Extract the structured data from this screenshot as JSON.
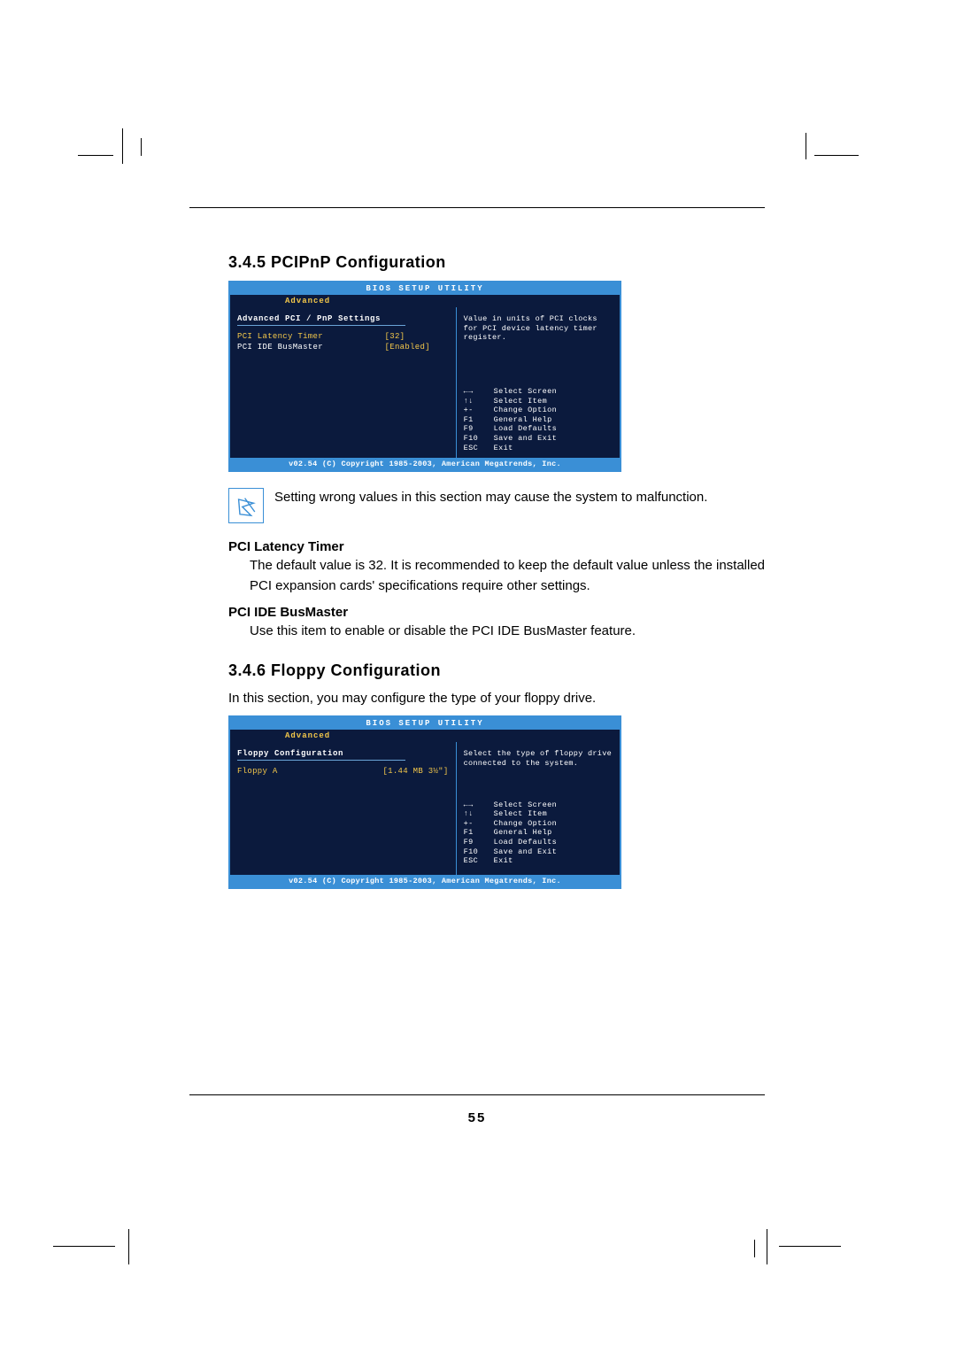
{
  "page_number": "55",
  "section_345": {
    "heading": "3.4.5 PCIPnP Configuration",
    "bios": {
      "title": "BIOS SETUP UTILITY",
      "tab": "Advanced",
      "panel_title": "Advanced PCI / PnP Settings",
      "items": [
        {
          "label": "PCI Latency Timer",
          "value": "[32]",
          "highlighted": true
        },
        {
          "label": "PCI IDE BusMaster",
          "value": "[Enabled]",
          "highlighted": false
        }
      ],
      "help_text": "Value in units of PCI clocks for PCI device latency timer register.",
      "legend": [
        {
          "key": "←→",
          "desc": "Select Screen"
        },
        {
          "key": "↑↓",
          "desc": "Select Item"
        },
        {
          "key": "+-",
          "desc": "Change Option"
        },
        {
          "key": "F1",
          "desc": "General Help"
        },
        {
          "key": "F9",
          "desc": "Load Defaults"
        },
        {
          "key": "F10",
          "desc": "Save and Exit"
        },
        {
          "key": "ESC",
          "desc": "Exit"
        }
      ],
      "copyright": "v02.54 (C) Copyright 1985-2003, American Megatrends, Inc."
    },
    "note": "Setting wrong values in this section may cause the system to malfunction.",
    "sub1": {
      "title": "PCI Latency Timer",
      "body": "The default value is 32. It is recommended to keep the default value unless the installed PCI expansion cards' specifications require other settings."
    },
    "sub2": {
      "title": "PCI IDE BusMaster",
      "body": "Use this item to enable or disable the PCI IDE BusMaster feature."
    }
  },
  "section_346": {
    "heading": "3.4.6 Floppy Configuration",
    "intro": "In this section, you may configure the type of your floppy drive.",
    "bios": {
      "title": "BIOS SETUP UTILITY",
      "tab": "Advanced",
      "panel_title": "Floppy Configuration",
      "items": [
        {
          "label": "Floppy A",
          "value": "[1.44 MB 3½\"]",
          "highlighted": true
        }
      ],
      "help_text": "Select the type of floppy drive connected to the system.",
      "legend": [
        {
          "key": "←→",
          "desc": "Select Screen"
        },
        {
          "key": "↑↓",
          "desc": "Select Item"
        },
        {
          "key": "+-",
          "desc": "Change Option"
        },
        {
          "key": "F1",
          "desc": "General Help"
        },
        {
          "key": "F9",
          "desc": "Load Defaults"
        },
        {
          "key": "F10",
          "desc": "Save and Exit"
        },
        {
          "key": "ESC",
          "desc": "Exit"
        }
      ],
      "copyright": "v02.54 (C) Copyright 1985-2003, American Megatrends, Inc."
    }
  }
}
